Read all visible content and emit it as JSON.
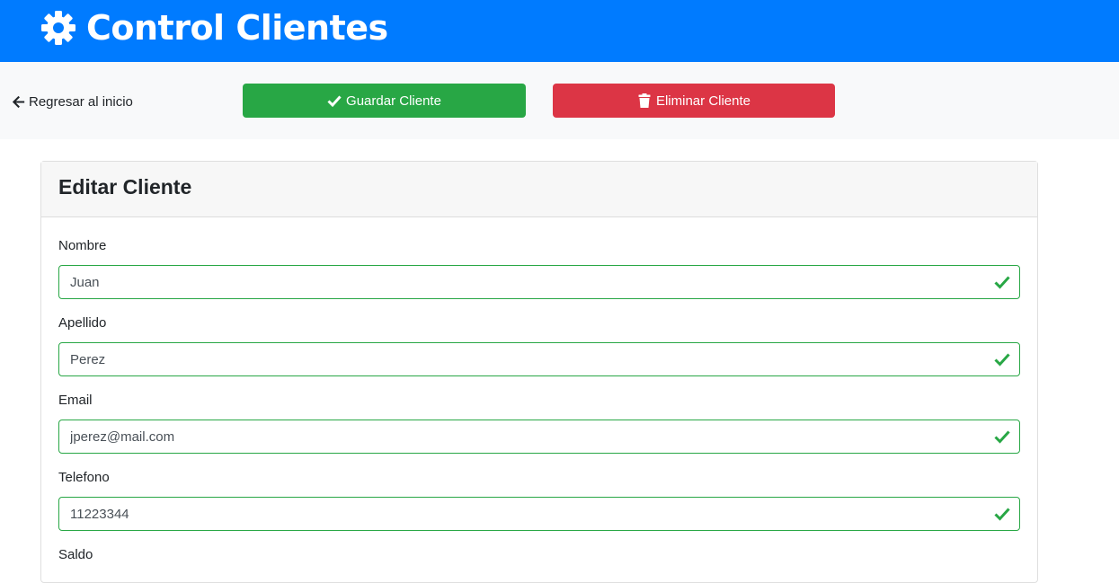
{
  "header": {
    "title": "Control Clientes",
    "icon": "gear-icon",
    "background": "#007bff"
  },
  "toolbar": {
    "back_label": "Regresar al inicio",
    "back_icon": "arrow-left-icon",
    "save_label": "Guardar Cliente",
    "save_icon": "check-icon",
    "save_color": "#28a745",
    "delete_label": "Eliminar Cliente",
    "delete_icon": "trash-icon",
    "delete_color": "#dc3545"
  },
  "card": {
    "title": "Editar Cliente"
  },
  "form": {
    "fields": [
      {
        "label": "Nombre",
        "value": "Juan",
        "valid": true
      },
      {
        "label": "Apellido",
        "value": "Perez",
        "valid": true
      },
      {
        "label": "Email",
        "value": "jperez@mail.com",
        "valid": true
      },
      {
        "label": "Telefono",
        "value": "11223344",
        "valid": true
      },
      {
        "label": "Saldo"
      }
    ],
    "valid_color": "#28a745"
  }
}
